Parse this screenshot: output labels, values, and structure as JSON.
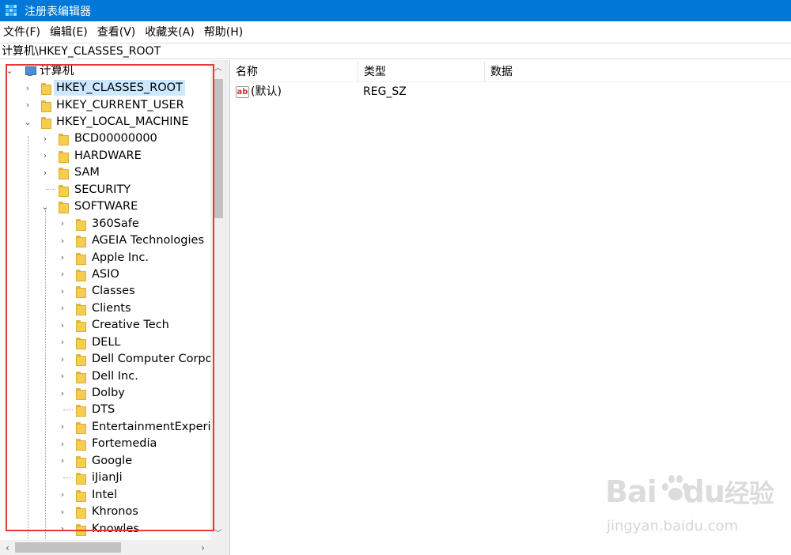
{
  "window": {
    "title": "注册表编辑器"
  },
  "menu": [
    "文件(F)",
    "编辑(E)",
    "查看(V)",
    "收藏夹(A)",
    "帮助(H)"
  ],
  "address": "计算机\\HKEY_CLASSES_ROOT",
  "tree": {
    "root": "计算机",
    "hives": [
      "HKEY_CLASSES_ROOT",
      "HKEY_CURRENT_USER",
      "HKEY_LOCAL_MACHINE"
    ],
    "hklm_children": [
      "BCD00000000",
      "HARDWARE",
      "SAM",
      "SECURITY",
      "SOFTWARE"
    ],
    "software_children": [
      "360Safe",
      "AGEIA Technologies",
      "Apple Inc.",
      "ASIO",
      "Classes",
      "Clients",
      "Creative Tech",
      "DELL",
      "Dell Computer Corpo",
      "Dell Inc.",
      "Dolby",
      "DTS",
      "EntertainmentExperie",
      "Fortemedia",
      "Google",
      "iJianJi",
      "Intel",
      "Khronos",
      "Knowles"
    ],
    "selected": "HKEY_CLASSES_ROOT"
  },
  "list": {
    "columns": [
      "名称",
      "类型",
      "数据"
    ],
    "rows": [
      {
        "icon": "string-value-icon",
        "icon_text": "ab",
        "name": "(默认)",
        "type": "REG_SZ",
        "data": ""
      }
    ]
  },
  "watermark": {
    "brand": "Bai",
    "brand2": "du",
    "brand_cn": "经验",
    "url": "jingyan.baidu.com"
  },
  "colors": {
    "titlebar": "#0078d7",
    "selection": "#cce8ff",
    "highlight_box": "#e53935"
  }
}
